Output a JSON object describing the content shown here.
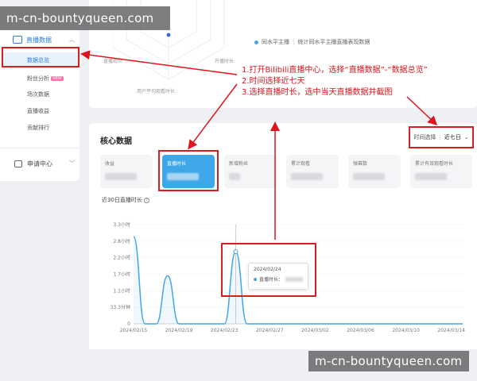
{
  "watermark": {
    "top": "m-cn-bountyqueen.com",
    "bottom": "m-cn-bountyqueen.com"
  },
  "sidebar": {
    "section_label": "直播数据",
    "items": [
      {
        "label": "数据总览",
        "active": true
      },
      {
        "label": "粉丝分析",
        "badge": "NEW"
      },
      {
        "label": "场次数据"
      },
      {
        "label": "直播收益"
      },
      {
        "label": "贡献排行"
      }
    ],
    "apply_label": "申请中心"
  },
  "radar": {
    "labels": [
      "直播观众",
      "开播时长",
      "用户平均观看时长"
    ],
    "legend_name": "同水平主播",
    "legend_desc": "统计同水平主播直播表现数据"
  },
  "annotation": {
    "lines": [
      "1.打开Bilibili直播中心，选择“直播数据”-“数据总览”",
      "2.时间选择近七天",
      "3.选择直播时长，选中当天直播数据并截图"
    ],
    "color": "#e0141e"
  },
  "core": {
    "title": "核心数据",
    "time_select_label": "时间选择",
    "time_select_value": "近七日",
    "metrics": [
      {
        "label": "收益"
      },
      {
        "label": "直播时长",
        "active": true
      },
      {
        "label": "新增粉丝"
      },
      {
        "label": "累计观看"
      },
      {
        "label": "弹幕数"
      },
      {
        "label": "累计有效观看时长"
      }
    ],
    "chart_label": "近30日直播时长"
  },
  "tooltip": {
    "date": "2024/02/24",
    "series_label": "直播时长："
  },
  "chart_data": {
    "type": "line",
    "title": "近30日直播时长",
    "x_ticks": [
      "2024/02/15",
      "2024/02/19",
      "2024/02/23",
      "2024/02/27",
      "2024/03/02",
      "2024/03/06",
      "2024/03/10",
      "2024/03/14"
    ],
    "y_ticks": [
      "0",
      "33.3分钟",
      "1.1小时",
      "1.7小时",
      "2.2小时",
      "2.8小时",
      "3.3小时"
    ],
    "ylim": [
      0,
      3.3
    ],
    "x_start": "2024/02/15",
    "x_end": "2024/03/15",
    "series": [
      {
        "color": "#3ea7e8",
        "points": [
          {
            "x": "2024/02/15",
            "y": 2.9
          },
          {
            "x": "2024/02/16",
            "y": 0
          },
          {
            "x": "2024/02/17",
            "y": 0
          },
          {
            "x": "2024/02/18",
            "y": 1.6
          },
          {
            "x": "2024/02/19",
            "y": 0
          },
          {
            "x": "2024/02/20",
            "y": 0
          },
          {
            "x": "2024/02/21",
            "y": 0
          },
          {
            "x": "2024/02/22",
            "y": 0
          },
          {
            "x": "2024/02/23",
            "y": 0
          },
          {
            "x": "2024/02/24",
            "y": 2.4
          },
          {
            "x": "2024/02/25",
            "y": 0
          },
          {
            "x": "2024/03/15",
            "y": 0
          }
        ]
      }
    ],
    "grid": true
  }
}
